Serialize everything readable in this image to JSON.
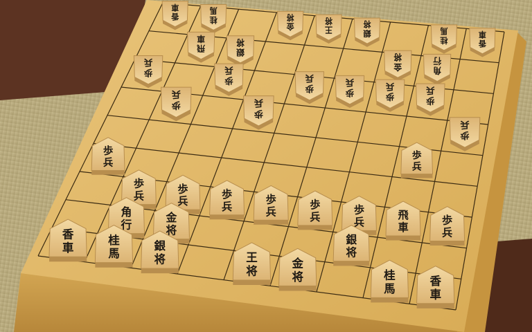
{
  "colors": {
    "tatami": "#b8aa7d",
    "tatami_dark": "#9e9167",
    "board_top": "#e2bb6a",
    "board_side": "#c99a45",
    "grid_line": "#3a2a12",
    "piece": "#e8c88a",
    "piece_edge": "#b88e4e",
    "wood_table": "#5a3120"
  },
  "pieces": [
    {
      "label": "王将",
      "orientation": "sente",
      "file": 5,
      "rank": 9
    },
    {
      "label": "金将",
      "orientation": "sente",
      "file": 4,
      "rank": 9
    },
    {
      "label": "金将",
      "orientation": "sente",
      "file": 7,
      "rank": 8
    },
    {
      "label": "銀将",
      "orientation": "sente",
      "file": 3,
      "rank": 8
    },
    {
      "label": "銀将",
      "orientation": "sente",
      "file": 7,
      "rank": 9
    },
    {
      "label": "桂馬",
      "orientation": "sente",
      "file": 8,
      "rank": 9
    },
    {
      "label": "桂馬",
      "orientation": "sente",
      "file": 2,
      "rank": 9
    },
    {
      "label": "香車",
      "orientation": "sente",
      "file": 9,
      "rank": 9
    },
    {
      "label": "香車",
      "orientation": "sente",
      "file": 1,
      "rank": 9
    },
    {
      "label": "角行",
      "orientation": "sente",
      "file": 8,
      "rank": 8
    },
    {
      "label": "飛車",
      "orientation": "sente",
      "file": 2,
      "rank": 7
    },
    {
      "label": "歩兵",
      "orientation": "sente",
      "file": 9,
      "rank": 6
    },
    {
      "label": "歩兵",
      "orientation": "sente",
      "file": 8,
      "rank": 7
    },
    {
      "label": "歩兵",
      "orientation": "sente",
      "file": 7,
      "rank": 7
    },
    {
      "label": "歩兵",
      "orientation": "sente",
      "file": 6,
      "rank": 7
    },
    {
      "label": "歩兵",
      "orientation": "sente",
      "file": 5,
      "rank": 7
    },
    {
      "label": "歩兵",
      "orientation": "sente",
      "file": 4,
      "rank": 7
    },
    {
      "label": "歩兵",
      "orientation": "sente",
      "file": 3,
      "rank": 7
    },
    {
      "label": "歩兵",
      "orientation": "sente",
      "file": 1,
      "rank": 7
    },
    {
      "label": "歩兵",
      "orientation": "sente",
      "file": 2,
      "rank": 5
    },
    {
      "label": "王将",
      "orientation": "gote",
      "file": 5,
      "rank": 1
    },
    {
      "label": "金将",
      "orientation": "gote",
      "file": 6,
      "rank": 1
    },
    {
      "label": "金将",
      "orientation": "gote",
      "file": 3,
      "rank": 2
    },
    {
      "label": "銀将",
      "orientation": "gote",
      "file": 7,
      "rank": 2
    },
    {
      "label": "銀将",
      "orientation": "gote",
      "file": 4,
      "rank": 1
    },
    {
      "label": "桂馬",
      "orientation": "gote",
      "file": 2,
      "rank": 1
    },
    {
      "label": "桂馬",
      "orientation": "gote",
      "file": 8,
      "rank": 1
    },
    {
      "label": "香車",
      "orientation": "gote",
      "file": 1,
      "rank": 1
    },
    {
      "label": "香車",
      "orientation": "gote",
      "file": 9,
      "rank": 1
    },
    {
      "label": "飛車",
      "orientation": "gote",
      "file": 8,
      "rank": 2
    },
    {
      "label": "角行",
      "orientation": "gote",
      "file": 2,
      "rank": 2
    },
    {
      "label": "歩兵",
      "orientation": "gote",
      "file": 9,
      "rank": 3
    },
    {
      "label": "歩兵",
      "orientation": "gote",
      "file": 8,
      "rank": 4
    },
    {
      "label": "歩兵",
      "orientation": "gote",
      "file": 7,
      "rank": 3
    },
    {
      "label": "歩兵",
      "orientation": "gote",
      "file": 6,
      "rank": 4
    },
    {
      "label": "歩兵",
      "orientation": "gote",
      "file": 5,
      "rank": 3
    },
    {
      "label": "歩兵",
      "orientation": "gote",
      "file": 4,
      "rank": 3
    },
    {
      "label": "歩兵",
      "orientation": "gote",
      "file": 3,
      "rank": 3
    },
    {
      "label": "歩兵",
      "orientation": "gote",
      "file": 2,
      "rank": 3
    },
    {
      "label": "歩兵",
      "orientation": "gote",
      "file": 1,
      "rank": 4
    }
  ]
}
